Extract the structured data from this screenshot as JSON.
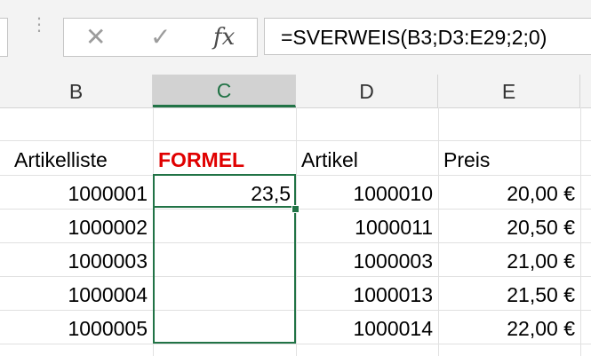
{
  "formula_bar": {
    "cancel_icon": "✕",
    "enter_icon": "✓",
    "fx_label": "fx",
    "grip_icon": "⋮",
    "formula": "=SVERWEIS(B3;D3:E29;2;0)"
  },
  "columns": [
    "B",
    "C",
    "D",
    "E"
  ],
  "selected_column": "C",
  "headers": {
    "b": "Artikelliste",
    "c": "FORMEL",
    "d": "Artikel",
    "e": "Preis"
  },
  "rows": [
    {
      "b": "1000001",
      "c": "23,5",
      "d": "1000010",
      "e": "20,00 €"
    },
    {
      "b": "1000002",
      "c": "",
      "d": "1000011",
      "e": "20,50 €"
    },
    {
      "b": "1000003",
      "c": "",
      "d": "1000003",
      "e": "21,00 €"
    },
    {
      "b": "1000004",
      "c": "",
      "d": "1000013",
      "e": "21,50 €"
    },
    {
      "b": "1000005",
      "c": "",
      "d": "1000014",
      "e": "22,00 €"
    }
  ],
  "colors": {
    "accent": "#217346",
    "formel_header": "#e00000"
  }
}
